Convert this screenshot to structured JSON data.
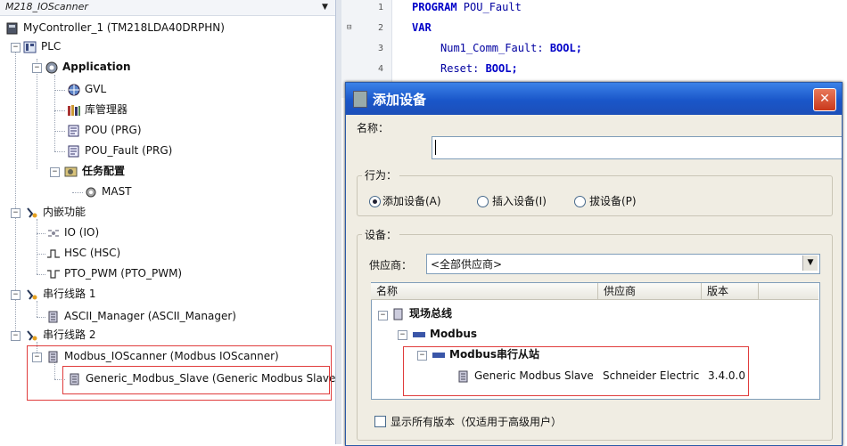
{
  "tree": {
    "title": "M218_IOScanner",
    "nodes": {
      "controller": "MyController_1 (TM218LDA40DRPHN)",
      "plc": "PLC",
      "application": "Application",
      "gvl": "GVL",
      "library": "库管理器",
      "pou": "POU (PRG)",
      "pou_fault": "POU_Fault (PRG)",
      "task_config": "任务配置",
      "mast": "MAST",
      "embedded": "内嵌功能",
      "io": "IO (IO)",
      "hsc": "HSC (HSC)",
      "pto": "PTO_PWM (PTO_PWM)",
      "serial1": "串行线路 1",
      "ascii": "ASCII_Manager (ASCII_Manager)",
      "serial2": "串行线路 2",
      "modbus_ioscanner": "Modbus_IOScanner (Modbus IOScanner)",
      "generic_slave": "Generic_Modbus_Slave (Generic Modbus Slave)"
    }
  },
  "editor": {
    "lines": [
      {
        "num": "1",
        "kw": "PROGRAM",
        "text": " POU_Fault"
      },
      {
        "num": "2",
        "kw": "VAR",
        "text": ""
      },
      {
        "num": "3",
        "kw": "",
        "text": "Num1_Comm_Fault: ",
        "type": "BOOL;"
      },
      {
        "num": "4",
        "kw": "",
        "text": "Reset: ",
        "type": "BOOL;"
      }
    ]
  },
  "dialog": {
    "title": "添加设备",
    "close": "✕",
    "name_label": "名称：",
    "name_value": "",
    "action_label": "行为：",
    "actions": [
      "添加设备(A)",
      "插入设备(I)",
      "拔设备(P)"
    ],
    "device_label": "设备：",
    "vendor_label": "供应商：",
    "vendor_value": "<全部供应商>",
    "columns": [
      "名称",
      "供应商",
      "版本"
    ],
    "list": {
      "fieldbus": "现场总线",
      "modbus": "Modbus",
      "serial_slave": "Modbus串行从站",
      "device": {
        "name": "Generic Modbus Slave",
        "vendor": "Schneider Electric",
        "version": "3.4.0.0"
      }
    },
    "show_all_versions": "显示所有版本（仅适用于高级用户）"
  }
}
